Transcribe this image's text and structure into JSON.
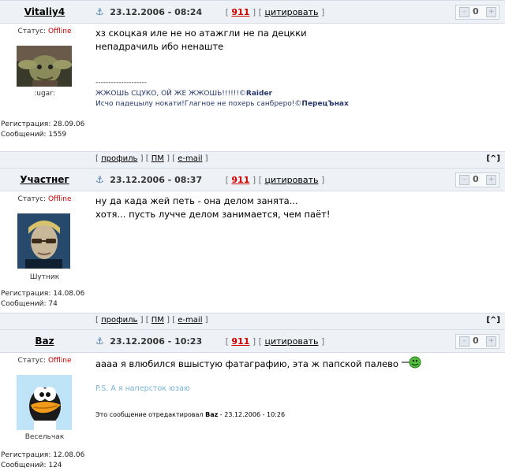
{
  "posts": [
    {
      "author": "Vitaliy4",
      "date": "23.12.2006 - 08:24",
      "post_number": "911",
      "quote_label": "цитировать",
      "rating": "0",
      "status_label": "Статус:",
      "status_value": "Offline",
      "rank": ":ugar:",
      "reg_label": "Регистрация:",
      "reg_value": "28.09.06",
      "posts_label": "Сообщений:",
      "posts_value": "1559",
      "lines": [
        "хз скоцкая иле не но атажгли не па децкки",
        "непадрачиль ибо ненаште"
      ],
      "signature_sep": "--------------------",
      "signature_line1": "ЖЖОШЬ СЦУКО, ОЙ ЖЕ ЖЖОШЬ!!!!!!©",
      "signature_line1_author": "Raider",
      "signature_line2": "Исчо падецылу нокати!Глагное не похерь санбреро!©",
      "signature_line2_author": "ПерецЪнах",
      "foot_profile": "профиль",
      "foot_pm": "ПМ",
      "foot_email": "e-mail",
      "top": "[^]"
    },
    {
      "author": "Участнег",
      "date": "23.12.2006 - 08:37",
      "post_number": "911",
      "quote_label": "цитировать",
      "rating": "0",
      "status_label": "Статус:",
      "status_value": "Offline",
      "rank": "Шутник",
      "reg_label": "Регистрация:",
      "reg_value": "14.08.06",
      "posts_label": "Сообщений:",
      "posts_value": "74",
      "lines": [
        "ну да када жей петь - она делом занята...",
        "хотя... пусть лучче делом занимается, чем паёт!"
      ],
      "foot_profile": "профиль",
      "foot_pm": "ПМ",
      "foot_email": "e-mail",
      "top": "[^]"
    },
    {
      "author": "Baz",
      "date": "23.12.2006 - 10:23",
      "post_number": "911",
      "quote_label": "цитировать",
      "rating": "0",
      "status_label": "Статус:",
      "status_value": "Offline",
      "rank": "Весельчак",
      "reg_label": "Регистрация:",
      "reg_value": "12.08.06",
      "posts_label": "Сообщений:",
      "posts_value": "124",
      "lines": [
        "аааа я влюбился вшыстую фатаграфию, эта ж папской палево"
      ],
      "ps": "P.S. А я наперсток юзаю",
      "edited_prefix": "Это сообщение отредактировал",
      "edited_author": "Baz",
      "edited_suffix": "- 23.12.2006 - 10:26"
    }
  ]
}
